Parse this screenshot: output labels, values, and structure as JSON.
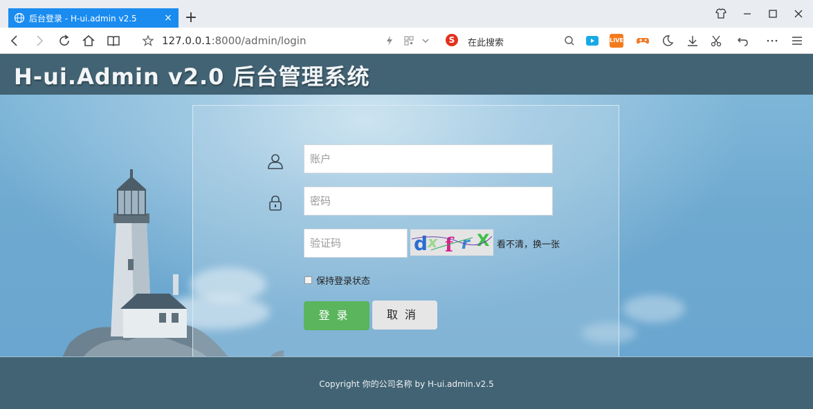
{
  "browser": {
    "tab_title": "后台登录 - H-ui.admin v2.5",
    "tab_close": "×",
    "new_tab": "+",
    "url_host": "127.0.0.1",
    "url_rest": ":8000/admin/login",
    "search_engine_text": "在此搜索",
    "search_engine_logo": "S",
    "live_badge": "LIVE"
  },
  "header": {
    "logo": "H-ui.Admin v2.0 后台管理系统"
  },
  "form": {
    "account_placeholder": "账户",
    "password_placeholder": "密码",
    "captcha_placeholder": "验证码",
    "captcha_text": "dxfrX",
    "captcha_refresh": "看不清，换一张",
    "remember_label": "保持登录状态",
    "login_button": "登录",
    "cancel_button": "取消"
  },
  "footer": {
    "copyright": "Copyright 你的公司名称 by H-ui.admin.v2.5"
  },
  "colors": {
    "tab_active": "#1a8cf0",
    "header_bg": "#426374",
    "login_green": "#5ab55d",
    "cancel_gray": "#e6e6e6"
  }
}
